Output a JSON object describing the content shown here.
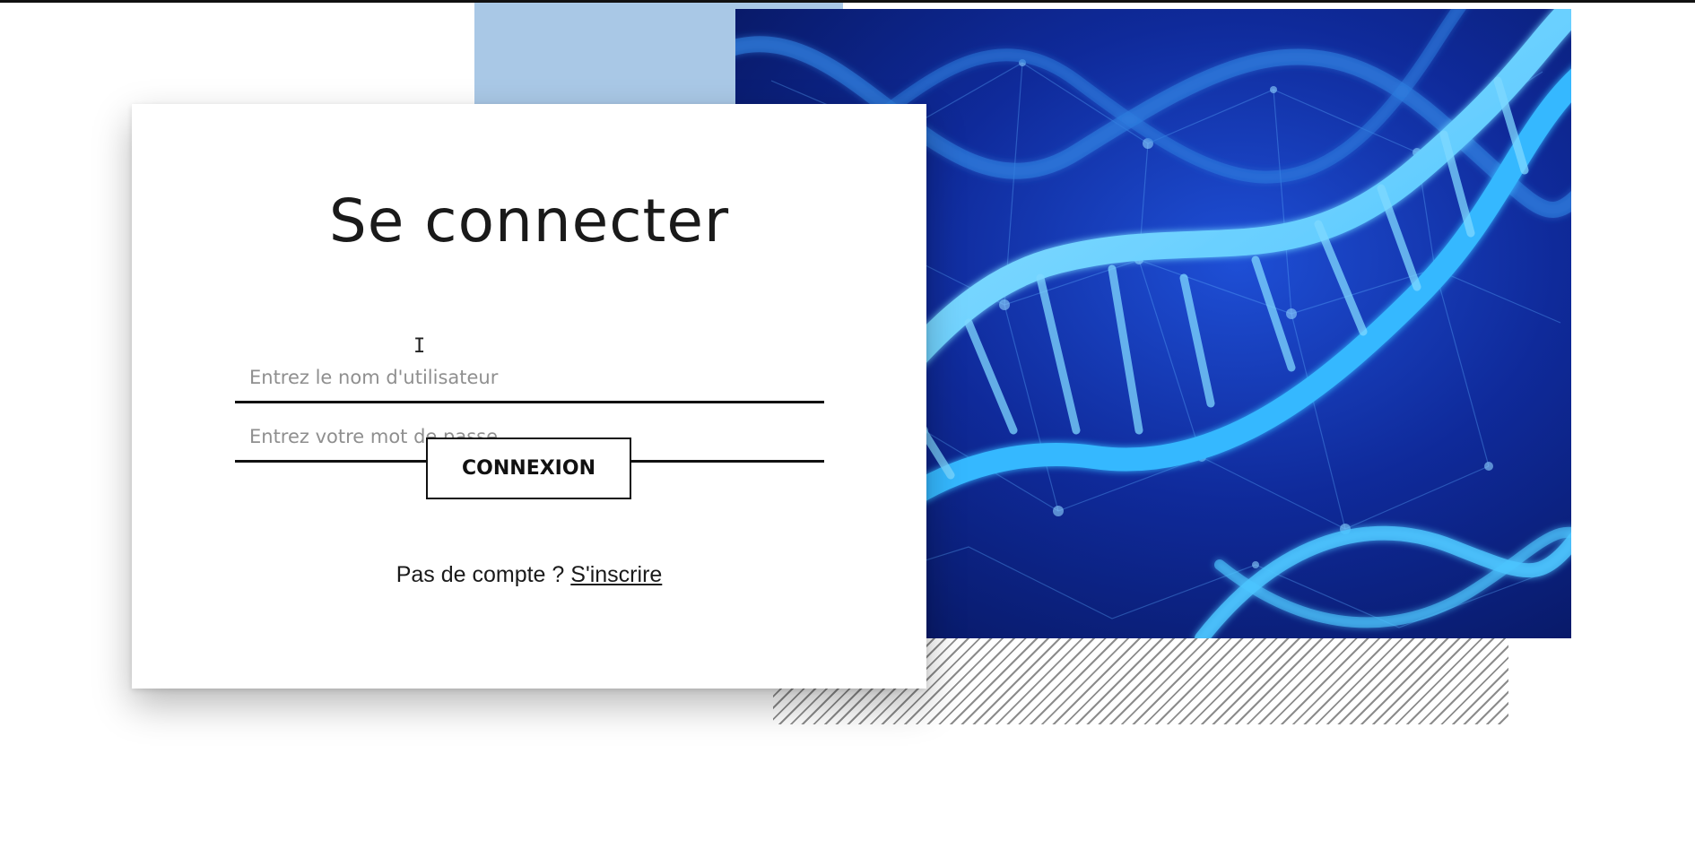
{
  "login": {
    "title": "Se connecter",
    "username_placeholder": "Entrez le nom d'utilisateur",
    "password_placeholder": "Entrez votre mot de passe",
    "submit_label": "CONNEXION",
    "signup_prompt": "Pas de compte ?",
    "signup_link": "S'inscrire"
  },
  "decor": {
    "image_subject": "dna-double-helix",
    "accent_blue": "#a9c8e6",
    "hatch_color": "#8c8c8c",
    "image_colors": [
      "#061457",
      "#1e4fd6",
      "#36b8ff",
      "#9fe8ff"
    ]
  },
  "cursor": {
    "icon": "text-cursor-icon"
  }
}
